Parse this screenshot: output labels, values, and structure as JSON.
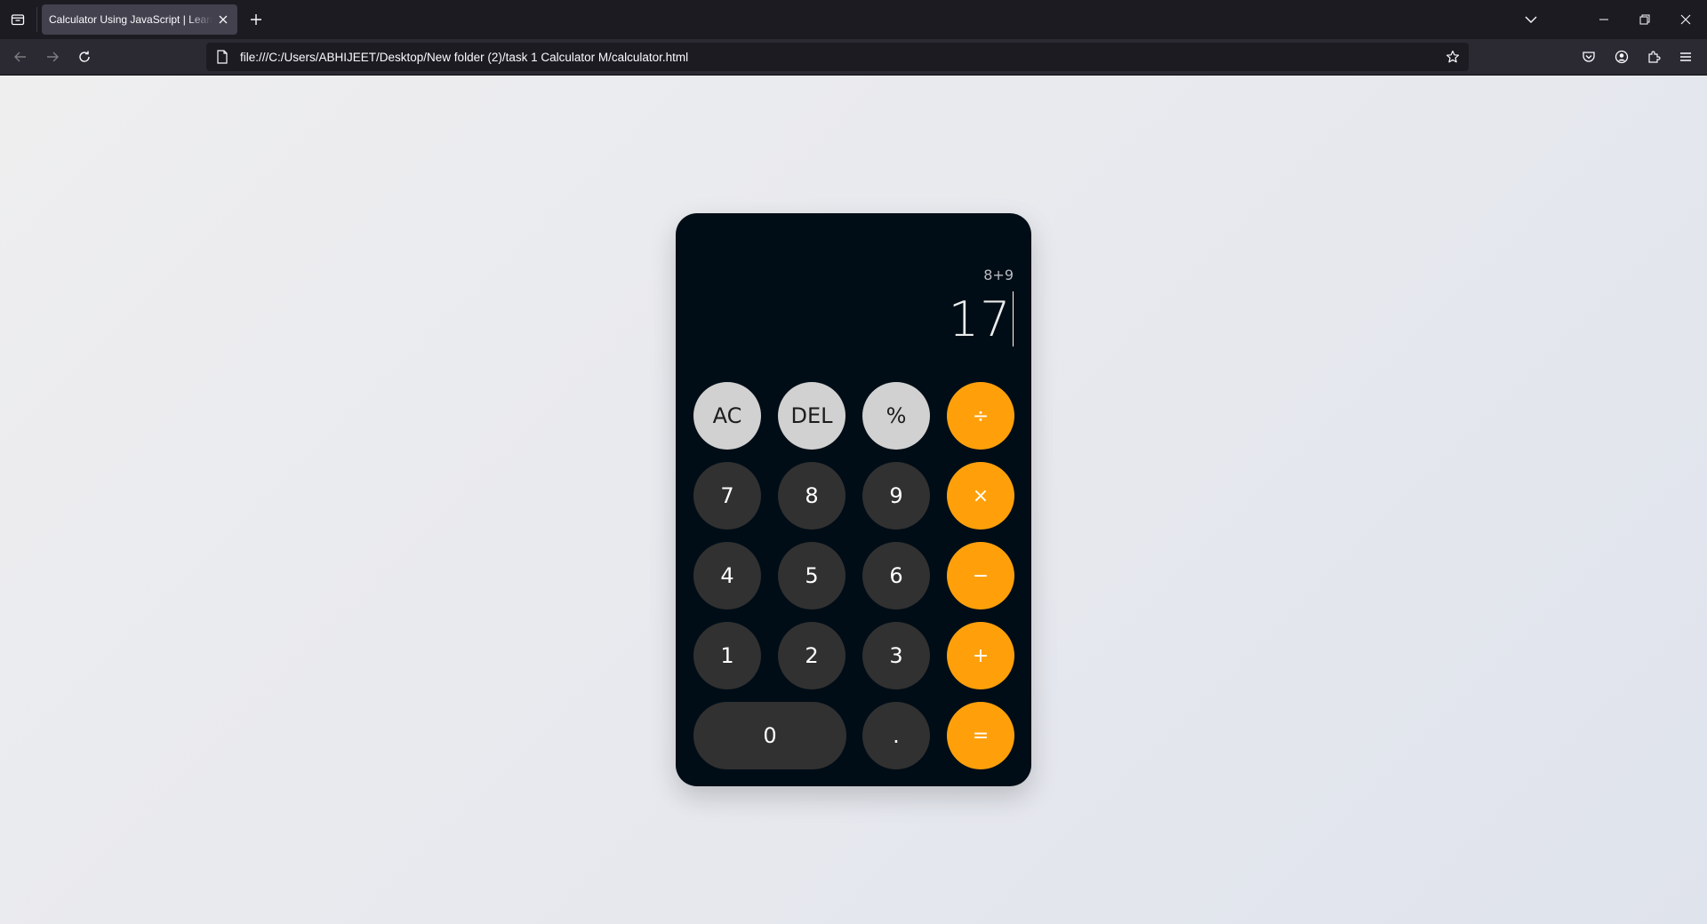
{
  "browser": {
    "tab_title": "Calculator Using JavaScript | Learn Coding",
    "url": "file:///C:/Users/ABHIJEET/Desktop/New folder (2)/task 1 Calculator M/calculator.html"
  },
  "calculator": {
    "expression": "8+9",
    "result": "17",
    "buttons": {
      "ac": "AC",
      "del": "DEL",
      "percent": "%",
      "divide": "÷",
      "seven": "7",
      "eight": "8",
      "nine": "9",
      "multiply": "×",
      "four": "4",
      "five": "5",
      "six": "6",
      "minus": "−",
      "one": "1",
      "two": "2",
      "three": "3",
      "plus": "+",
      "zero": "0",
      "dot": ".",
      "equals": "="
    },
    "colors": {
      "body": "#010d16",
      "function_key": "#d1d1d1",
      "number_key": "#313131",
      "operator_key": "#ffa00a"
    }
  }
}
